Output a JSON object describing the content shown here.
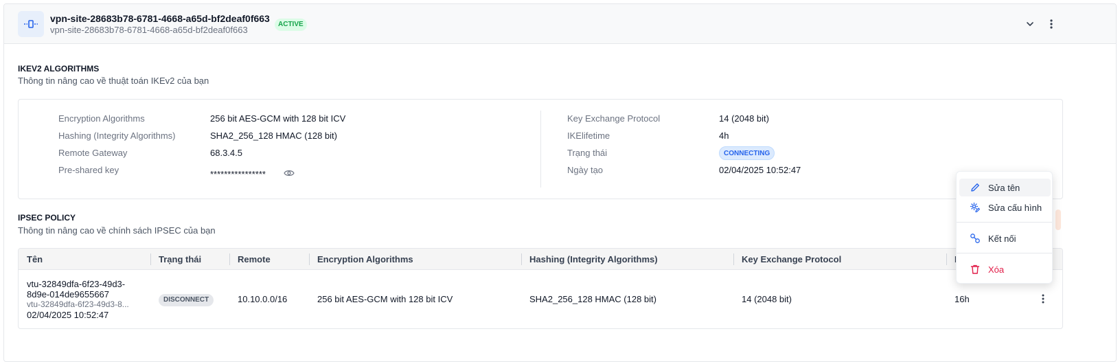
{
  "header": {
    "title": "vpn-site-28683b78-6781-4668-a65d-bf2deaf0f663",
    "subtitle": "vpn-site-28683b78-6781-4668-a65d-bf2deaf0f663",
    "status": "ACTIVE",
    "icon": "vpn-link-icon"
  },
  "ikev2": {
    "title": "IKEV2 ALGORITHMS",
    "subtitle": "Thông tin nâng cao về thuật toán IKEv2 của bạn",
    "left": [
      {
        "label": "Encryption Algorithms",
        "value": "256 bit AES-GCM with 128 bit ICV"
      },
      {
        "label": "Hashing (Integrity Algorithms)",
        "value": "SHA2_256_128 HMAC (128 bit)"
      },
      {
        "label": "Remote Gateway",
        "value": "68.3.4.5"
      },
      {
        "label": "Pre-shared key",
        "value": "****************"
      }
    ],
    "right": [
      {
        "label": "Key Exchange Protocol",
        "value": "14 (2048 bit)"
      },
      {
        "label": "IKElifetime",
        "value": "4h"
      },
      {
        "label": "Trạng thái",
        "value": "CONNECTING"
      },
      {
        "label": "Ngày tạo",
        "value": "02/04/2025 10:52:47"
      }
    ]
  },
  "ipsec": {
    "title": "IPSEC POLICY",
    "subtitle": "Thông tin nâng cao về chính sách IPSEC của bạn",
    "columns": [
      "Tên",
      "Trạng thái",
      "Remote",
      "Encryption Algorithms",
      "Hashing (Integrity Algorithms)",
      "Key Exchange Protocol",
      "IK"
    ],
    "rows": [
      {
        "name_line1": "vtu-32849dfa-6f23-49d3-",
        "name_line2": "8d9e-014de9655667",
        "name_sub": "vtu-32849dfa-6f23-49d3-8...",
        "created": "02/04/2025 10:52:47",
        "status": "DISCONNECT",
        "remote": "10.10.0.0/16",
        "encryption": "256 bit AES-GCM with 128 bit ICV",
        "hashing": "SHA2_256_128 HMAC (128 bit)",
        "key_exchange": "14 (2048 bit)",
        "lifetime": "16h"
      }
    ]
  },
  "context_menu": {
    "items": [
      {
        "label": "Sửa tên",
        "icon": "pencil-icon"
      },
      {
        "label": "Sửa cấu hình",
        "icon": "settings-edit-icon"
      },
      {
        "label": "Kết nối",
        "icon": "connect-icon"
      },
      {
        "label": "Xóa",
        "icon": "trash-icon"
      }
    ]
  },
  "colors": {
    "accent": "#2563eb",
    "active_green": "#16a34a",
    "danger": "#e11d48"
  }
}
